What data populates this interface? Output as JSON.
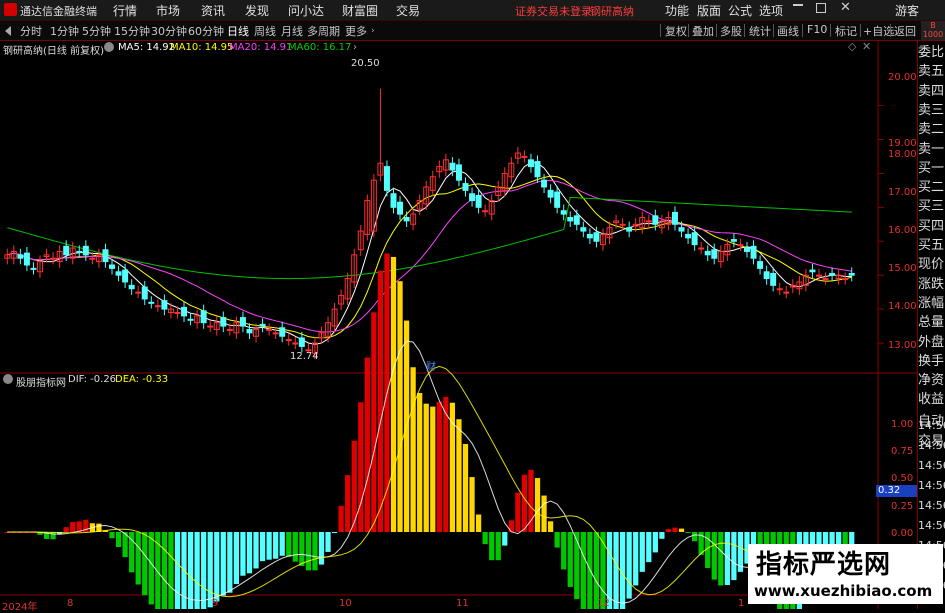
{
  "app": {
    "title": "通达信金融终端"
  },
  "menu": {
    "items": [
      "行情",
      "市场",
      "资讯",
      "发现",
      "问小达",
      "财富圈",
      "交易"
    ],
    "notice": "证券交易未登录",
    "stock_name": "钢研高纳",
    "right_items": [
      "功能",
      "版面",
      "公式",
      "选项"
    ],
    "guest": "游客"
  },
  "toolbar": {
    "periods": [
      "分时",
      "1分钟",
      "5分钟",
      "15分钟",
      "30分钟",
      "60分钟",
      "日线",
      "周线",
      "月线",
      "多周期",
      "更多"
    ],
    "active": "日线",
    "right": [
      "复权",
      "叠加",
      "多股",
      "统计",
      "画线",
      "F10",
      "标记",
      "+自选",
      "返回"
    ]
  },
  "main_legend": {
    "name": "钢研高纳(日线 前复权)",
    "ma5": "MA5: 14.92",
    "ma10": "MA10: 14.95",
    "ma20": "MA20: 14.91",
    "ma60": "MA60: 16.17"
  },
  "price_axis": [
    "20.00",
    "19.00",
    "18.00",
    "17.00",
    "16.00",
    "15.00",
    "14.00",
    "13.00"
  ],
  "annotations": {
    "high": "20.50",
    "low": "12.74",
    "fin": "财"
  },
  "indicator_legend": {
    "name": "股朋指标网",
    "dif": "DIF: -0.26",
    "dea": "DEA: -0.33"
  },
  "indicator_axis": [
    "1.00",
    "0.75",
    "0.50",
    "0.25",
    "0.00"
  ],
  "indicator_current": "0.32",
  "dates": {
    "year": "2024年",
    "m8": "8",
    "m9": "9",
    "m10": "10",
    "m11": "11",
    "m12": "12",
    "m1": "1"
  },
  "sidebar": [
    "委比",
    "卖五",
    "卖四",
    "卖三",
    "卖二",
    "卖一",
    "买一",
    "买二",
    "买三",
    "买四",
    "买五",
    "现价",
    "涨跌",
    "涨幅",
    "总量",
    "外盘",
    "换手",
    "净资",
    "收益",
    "自动",
    "交易"
  ],
  "times": [
    "14:56",
    "14:56",
    "14:56",
    "14:56",
    "14:56",
    "14:56",
    "14:56",
    "14:56",
    "14:56"
  ],
  "watermark": {
    "title": "指标严选网",
    "url": "www.xuezhibiao.com"
  },
  "colors": {
    "up": "#ff3030",
    "down": "#54ffff",
    "ma5": "#ffffff",
    "ma10": "#ffff00",
    "ma20": "#ff40ff",
    "ma60": "#00c000",
    "macd_up_red": "#e00000",
    "macd_up_yellow": "#ffd700",
    "macd_dn_green": "#00c800",
    "macd_dn_cyan": "#54ffff"
  },
  "chart_data": {
    "type": "candlestick",
    "ma_last": {
      "MA5": 14.92,
      "MA10": 14.95,
      "MA20": 14.91,
      "MA60": 16.17
    },
    "price_range": [
      12.5,
      20.9
    ],
    "closes": [
      15.6,
      15.7,
      15.5,
      15.3,
      15.2,
      15.4,
      15.6,
      15.5,
      15.7,
      15.6,
      15.8,
      15.7,
      15.6,
      15.5,
      15.6,
      15.4,
      15.2,
      15.0,
      14.8,
      14.6,
      14.5,
      14.3,
      14.2,
      14.1,
      14.0,
      14.0,
      13.9,
      13.8,
      13.7,
      13.8,
      13.6,
      13.5,
      13.6,
      13.5,
      13.4,
      13.6,
      13.5,
      13.3,
      13.4,
      13.5,
      13.4,
      13.3,
      13.2,
      13.1,
      13.0,
      12.9,
      12.8,
      13.0,
      13.3,
      13.6,
      14.0,
      14.4,
      14.9,
      15.6,
      16.3,
      17.2,
      17.8,
      18.3,
      17.5,
      17.0,
      16.8,
      16.6,
      16.8,
      17.2,
      17.6,
      17.9,
      18.2,
      18.4,
      18.1,
      17.8,
      17.5,
      17.2,
      17.0,
      16.9,
      17.2,
      17.6,
      18.0,
      18.3,
      18.6,
      18.5,
      18.2,
      17.9,
      17.6,
      17.3,
      17.0,
      16.8,
      16.6,
      16.5,
      16.3,
      16.1,
      16.0,
      16.2,
      16.4,
      16.6,
      16.5,
      16.3,
      16.5,
      16.7,
      16.6,
      16.5,
      16.6,
      16.7,
      16.5,
      16.3,
      16.1,
      15.9,
      15.8,
      15.6,
      15.5,
      15.7,
      15.9,
      16.0,
      15.9,
      15.7,
      15.5,
      15.2,
      14.9,
      14.7,
      14.6,
      14.5,
      14.7,
      14.8,
      15.0,
      15.1,
      15.0,
      14.9,
      15.0,
      15.0,
      14.9,
      15.0
    ],
    "macd_dif_last": -0.26,
    "macd_dea_last": -0.33,
    "macd_range": [
      -0.25,
      1.2
    ]
  }
}
